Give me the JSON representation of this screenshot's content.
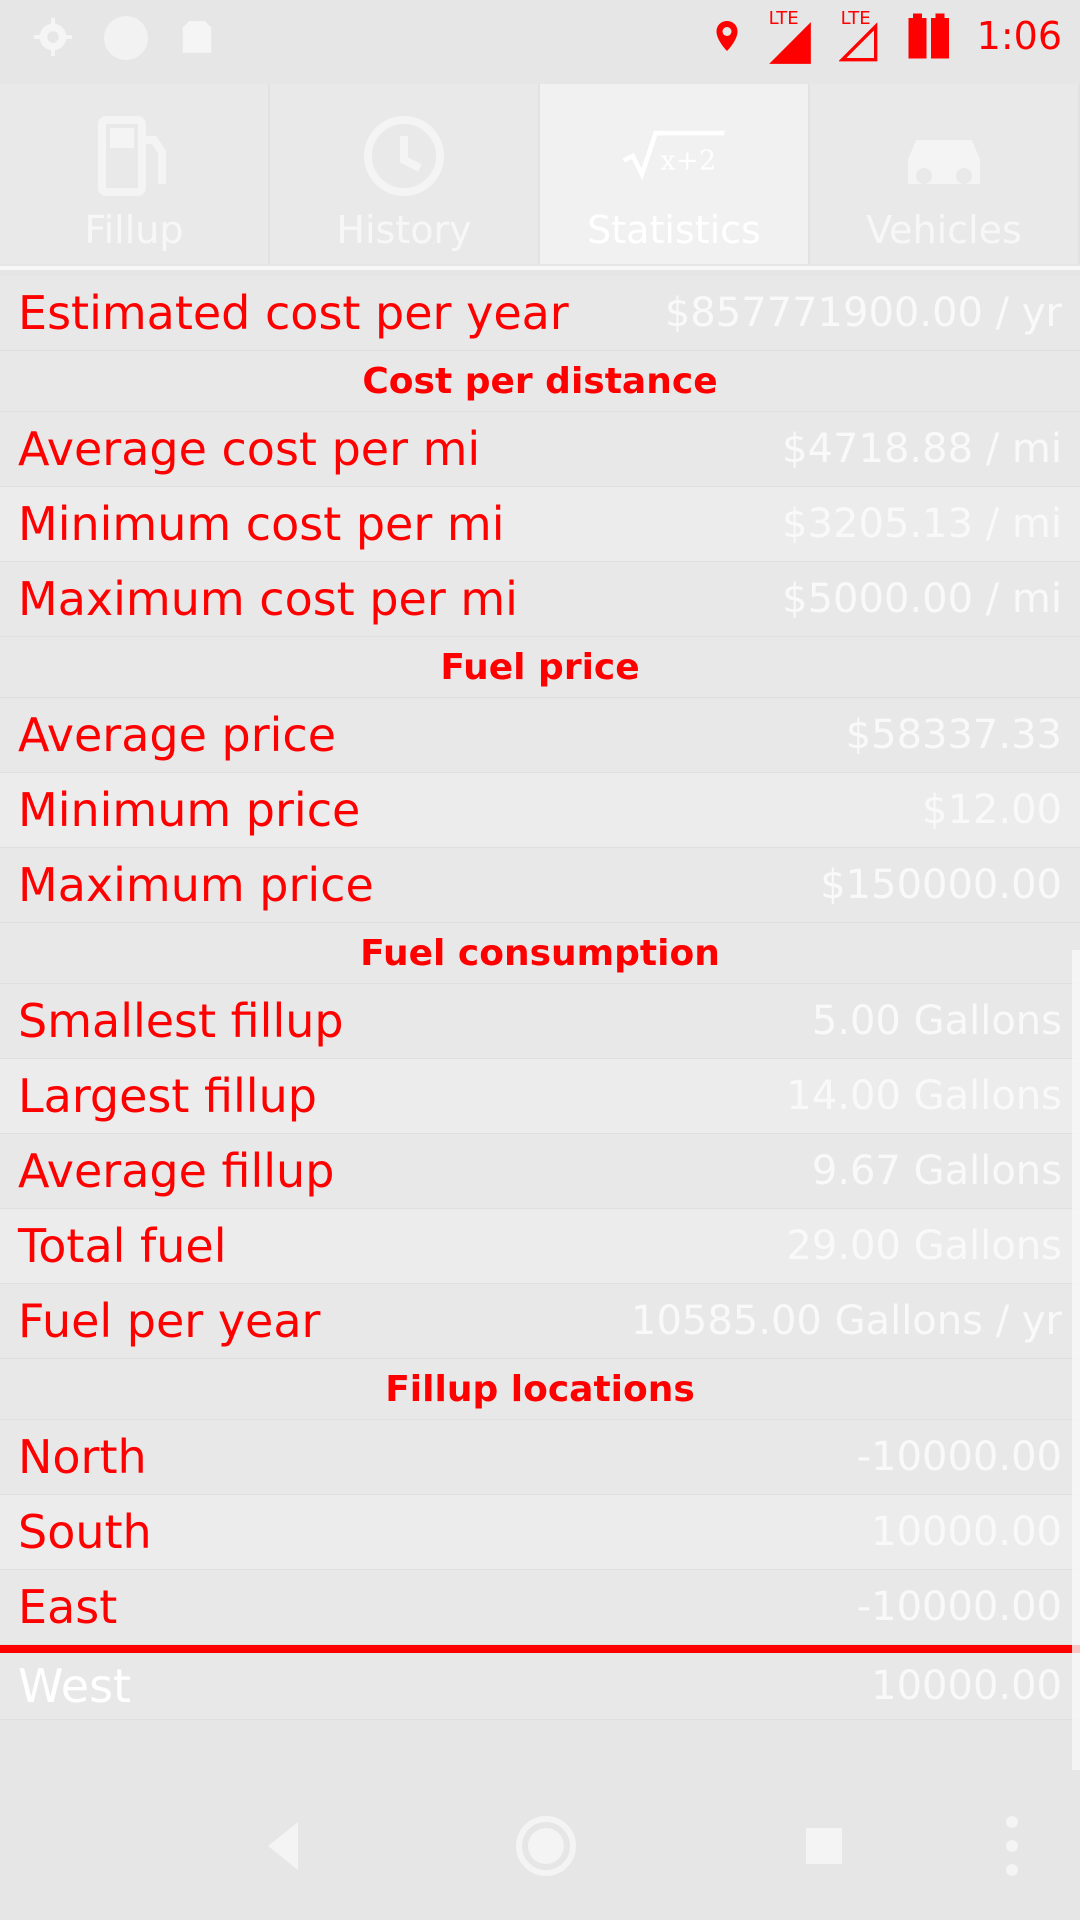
{
  "status_bar": {
    "time": "1:06",
    "icons": [
      "gear-icon",
      "circle-icon",
      "sdcard-icon",
      "location-icon",
      "lte-icon",
      "lte-icon",
      "battery-icon"
    ],
    "network_labels": [
      "LTE",
      "LTE"
    ]
  },
  "tabs": [
    {
      "label": "Fillup",
      "icon": "gas-pump-icon",
      "active": false
    },
    {
      "label": "History",
      "icon": "clock-icon",
      "active": false
    },
    {
      "label": "Statistics",
      "icon": "sqrt-x-plus-2-icon",
      "active": true
    },
    {
      "label": "Vehicles",
      "icon": "car-icon",
      "active": false
    }
  ],
  "content": {
    "top_row": {
      "label": "Estimated cost per year",
      "value": "$857771900.00 / yr"
    },
    "sections": [
      {
        "title": "Cost per distance",
        "rows": [
          {
            "label": "Average cost per mi",
            "value": "$4718.88 / mi"
          },
          {
            "label": "Minimum cost per mi",
            "value": "$3205.13 / mi"
          },
          {
            "label": "Maximum cost per mi",
            "value": "$5000.00 / mi"
          }
        ]
      },
      {
        "title": "Fuel price",
        "rows": [
          {
            "label": "Average price",
            "value": "$58337.33"
          },
          {
            "label": "Minimum price",
            "value": "$12.00"
          },
          {
            "label": "Maximum price",
            "value": "$150000.00"
          }
        ]
      },
      {
        "title": "Fuel consumption",
        "rows": [
          {
            "label": "Smallest fillup",
            "value": "5.00 Gallons"
          },
          {
            "label": "Largest fillup",
            "value": "14.00 Gallons"
          },
          {
            "label": "Average fillup",
            "value": "9.67 Gallons"
          },
          {
            "label": "Total fuel",
            "value": "29.00 Gallons"
          },
          {
            "label": "Fuel per year",
            "value": "10585.00 Gallons / yr"
          }
        ]
      },
      {
        "title": "Fillup locations",
        "rows": [
          {
            "label": "North",
            "value": "-10000.00"
          },
          {
            "label": "South",
            "value": "10000.00"
          },
          {
            "label": "East",
            "value": "-10000.00"
          },
          {
            "label": "West",
            "value": "10000.00"
          }
        ]
      }
    ]
  },
  "nav_bar": {
    "buttons": [
      "back-icon",
      "home-icon",
      "recents-icon",
      "more-icon"
    ]
  },
  "colors": {
    "accent": "#ff0000",
    "background": "#e6e6e6",
    "white_text": "#f9f9f9"
  }
}
